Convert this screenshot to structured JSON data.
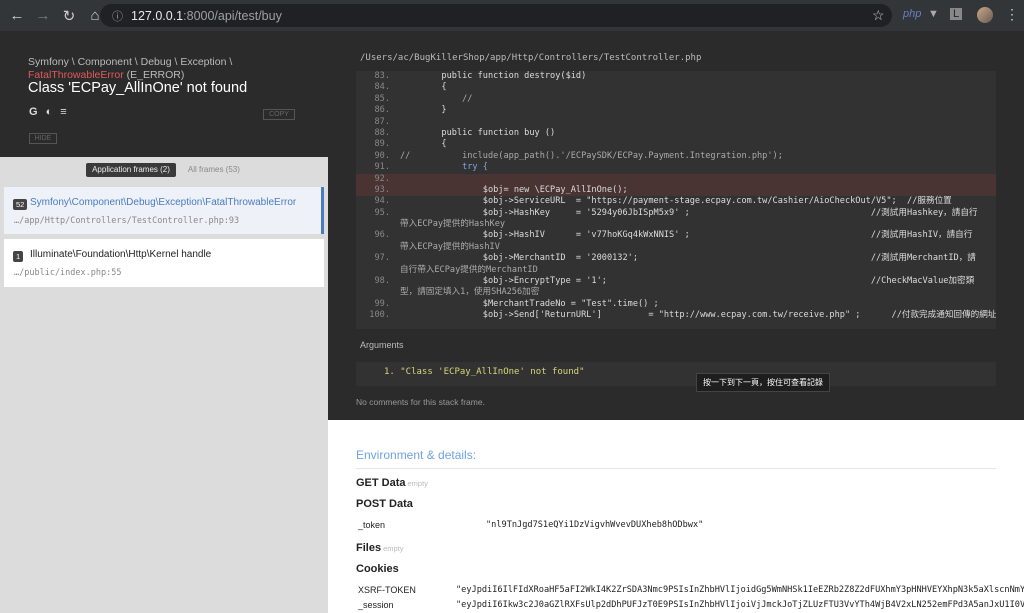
{
  "browser": {
    "url_host": "127.0.0.1",
    "url_rest": ":8000/api/test/buy",
    "ext_labels": [
      "php",
      "▼",
      "L"
    ]
  },
  "exception": {
    "namespace": "Symfony \\ Component \\ Debug \\ Exception \\",
    "fatal_class": "FatalThrowableError",
    "error_type": " (E_ERROR)",
    "message": "Class 'ECPay_AllInOne' not found",
    "copy_label": "COPY",
    "hide_label": "HIDE"
  },
  "frames": {
    "tab_app": "Application frames (2)",
    "tab_all": "All frames (53)",
    "items": [
      {
        "num": "52",
        "cls": "Symfony\\Component\\Debug\\Exception\\FatalThrowableError",
        "file": "…/app/Http/Controllers/TestController.php:93"
      },
      {
        "num": "1",
        "cls": "Illuminate\\Foundation\\Http\\Kernel handle",
        "file": "…/public/index.php:55"
      }
    ]
  },
  "code": {
    "file_path": "/Users/ac/BugKillerShop/app/Http/Controllers/TestController.php",
    "lines": [
      {
        "n": "83.",
        "t": "        public function destroy($id)"
      },
      {
        "n": "84.",
        "t": "        {"
      },
      {
        "n": "85.",
        "t": "            //"
      },
      {
        "n": "86.",
        "t": "        }"
      },
      {
        "n": "87.",
        "t": ""
      },
      {
        "n": "88.",
        "t": "        public function buy ()"
      },
      {
        "n": "89.",
        "t": "        {"
      },
      {
        "n": "90.",
        "t": "//          include(app_path().'/ECPaySDK/ECPay.Payment.Integration.php');"
      },
      {
        "n": "91.",
        "t": "            try {"
      },
      {
        "n": "92.",
        "t": ""
      },
      {
        "n": "93.",
        "t": "                $obj= new \\ECPay_AllInOne();"
      },
      {
        "n": "94.",
        "t": "                $obj->ServiceURL  = \"https://payment-stage.ecpay.com.tw/Cashier/AioCheckOut/V5\";  //服務位置"
      },
      {
        "n": "95.",
        "t": "                $obj->HashKey     = '5294y06JbISpM5x9' ;                                   //測試用Hashkey，請自行"
      },
      {
        "n": "",
        "t": "帶入ECPay提供的HashKey"
      },
      {
        "n": "96.",
        "t": "                $obj->HashIV      = 'v77hoKGq4kWxNNIS' ;                                   //測試用HashIV，請自行"
      },
      {
        "n": "",
        "t": "帶入ECPay提供的HashIV"
      },
      {
        "n": "97.",
        "t": "                $obj->MerchantID  = '2000132';                                             //測試用MerchantID，請"
      },
      {
        "n": "",
        "t": "自行帶入ECPay提供的MerchantID"
      },
      {
        "n": "98.",
        "t": "                $obj->EncryptType = '1';                                                   //CheckMacValue加密類"
      },
      {
        "n": "",
        "t": "型，請固定填入1，使用SHA256加密"
      },
      {
        "n": "99.",
        "t": "                $MerchantTradeNo = \"Test\".time() ;"
      },
      {
        "n": "100.",
        "t": "                $obj->Send['ReturnURL']         = \"http://www.ecpay.com.tw/receive.php\" ;      //付款完成通知回傳的網址"
      }
    ],
    "arguments_label": "Arguments",
    "argument_1": "1. \"Class 'ECPay_AllInOne' not found\"",
    "tooltip": "按一下到下一頁，按住可查看記錄",
    "no_comments": "No comments for this stack frame."
  },
  "env": {
    "title": "Environment & details:",
    "get_label": "GET Data",
    "get_empty": "empty",
    "post_label": "POST Data",
    "token_key": "_token",
    "token_val": "\"nl9TnJgd7S1eQYi1DzVigvhWvevDUXheb8hODbwx\"",
    "files_label": "Files",
    "files_empty": "empty",
    "cookies_label": "Cookies",
    "xsrf_key": "XSRF-TOKEN",
    "xsrf_val": "\"eyJpdiI6IlFIdXRoaHF5aFI2WkI4K2ZrSDA3Nmc9PSIsInZhbHVlIjoidGg5WmNHSk1IeEZRb2Z8Z2dFUXhmY3pHNHVEYXhpN3k5aXlscnNmYT",
    "session_key": "_session",
    "session_val": "\"eyJpdiI6Ikw3c2J0aGZlRXFsUlp2dDhPUFJzT0E9PSIsInZhbHVlIjoiVjJmckJoTjZLUzFTU3VvYTh4WjB4V2xLN252emFPd3A5anJxU1I0Vk"
  }
}
